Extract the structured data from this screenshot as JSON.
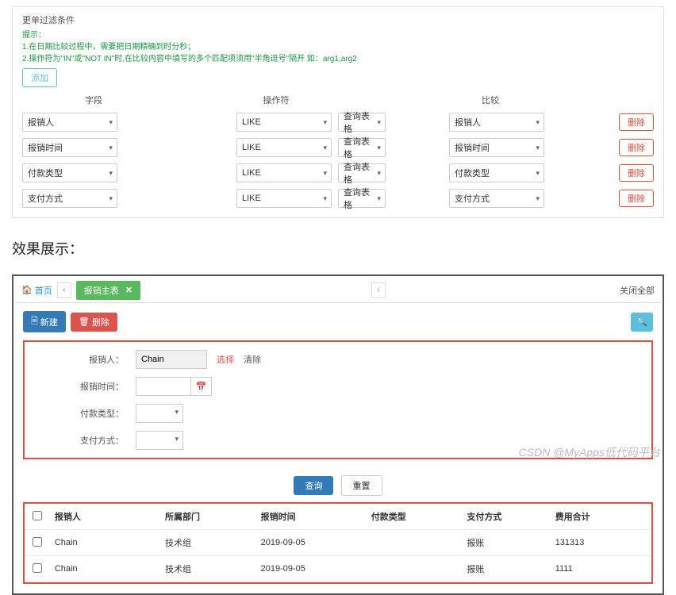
{
  "config": {
    "title": "更单过滤条件",
    "hint_label": "提示：",
    "hint1": "1.在日期比较过程中，需要把日期精确到时分秒；",
    "hint2": "2.操作符为\"IN\"或\"NOT IN\"时,在比较内容中填写的多个匹配项须用\"半角逗号\"隔开 如：arg1,arg2",
    "add_btn": "添加",
    "headers": {
      "field": "字段",
      "operator": "操作符",
      "compare": "比较"
    },
    "rows": [
      {
        "field": "报销人",
        "op": "LIKE",
        "q": "查询表格",
        "cmp": "报销人",
        "del": "删除"
      },
      {
        "field": "报销时间",
        "op": "LIKE",
        "q": "查询表格",
        "cmp": "报销时间",
        "del": "删除"
      },
      {
        "field": "付款类型",
        "op": "LIKE",
        "q": "查询表格",
        "cmp": "付款类型",
        "del": "删除"
      },
      {
        "field": "支付方式",
        "op": "LIKE",
        "q": "查询表格",
        "cmp": "支付方式",
        "del": "删除"
      }
    ]
  },
  "section_title": "效果展示：",
  "result": {
    "nav": {
      "home": "首页",
      "tab": "报销主表",
      "close_all": "关闭全部"
    },
    "toolbar": {
      "new": "新建",
      "delete": "删除"
    },
    "form": {
      "labels": {
        "person": "报销人：",
        "time": "报销时间：",
        "paytype": "付款类型：",
        "paymethod": "支付方式："
      },
      "person_value": "Chain",
      "select_link": "选择",
      "clear_link": "清除"
    },
    "actions": {
      "query": "查询",
      "reset": "重置"
    },
    "table": {
      "headers": {
        "person": "报销人",
        "dept": "所属部门",
        "time": "报销时间",
        "paytype": "付款类型",
        "paymethod": "支付方式",
        "total": "费用合计"
      },
      "rows": [
        {
          "person": "Chain",
          "dept": "技术组",
          "time": "2019-09-05",
          "paytype": "",
          "paymethod": "报账",
          "total": "131313"
        },
        {
          "person": "Chain",
          "dept": "技术组",
          "time": "2019-09-05",
          "paytype": "",
          "paymethod": "报账",
          "total": "1111"
        }
      ]
    }
  },
  "watermark": "CSDN @MyApps低代码平台"
}
